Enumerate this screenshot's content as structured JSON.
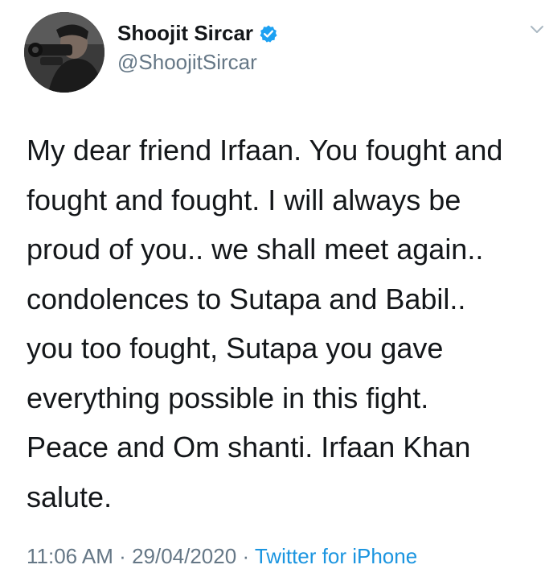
{
  "author": {
    "name": "Shoojit Sircar",
    "handle": "@ShoojitSircar",
    "verified": true,
    "verified_color": "#1da1f2"
  },
  "tweet": {
    "lines": [
      "My dear friend Irfaan. You fought and",
      "fought and fought. I will always be",
      "proud of you.. we shall meet again..",
      "condolences to Sutapa and Babil..",
      "you too fought, Sutapa you gave",
      "everything possible in this fight.",
      "Peace and Om shanti. Irfaan Khan",
      "salute."
    ]
  },
  "meta": {
    "time": "11:06 AM",
    "separator": "·",
    "date": "29/04/2020",
    "source": "Twitter for iPhone"
  },
  "icons": {
    "verified": "verified-badge-icon",
    "more": "chevron-down-icon"
  },
  "colors": {
    "text": "#14171a",
    "secondary": "#657786",
    "link": "#1b95e0"
  }
}
